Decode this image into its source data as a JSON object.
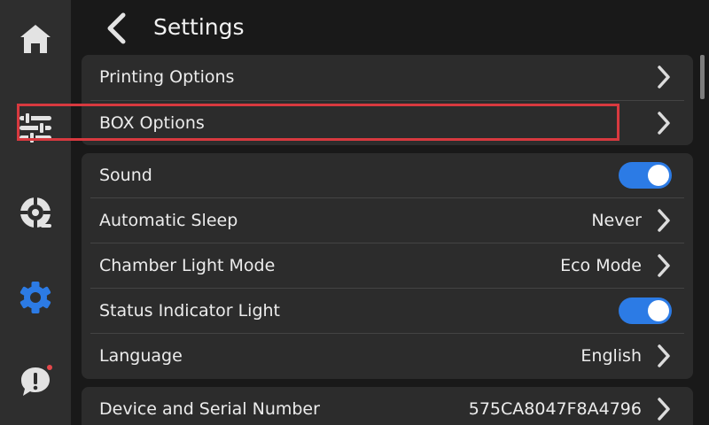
{
  "header": {
    "title": "Settings"
  },
  "colors": {
    "accent": "#2c7be5",
    "highlight": "#d8393f"
  },
  "sidebar": {
    "items": [
      {
        "name": "home",
        "icon": "home-icon"
      },
      {
        "name": "controls",
        "icon": "sliders-icon"
      },
      {
        "name": "filament",
        "icon": "filament-spool-icon"
      },
      {
        "name": "settings",
        "icon": "gear-icon",
        "active": true
      },
      {
        "name": "messages",
        "icon": "alert-message-icon",
        "badge": true
      }
    ]
  },
  "groups": [
    {
      "rows": [
        {
          "label": "Printing Options",
          "type": "link"
        },
        {
          "label": "BOX Options",
          "type": "link",
          "highlighted": true
        }
      ]
    },
    {
      "rows": [
        {
          "label": "Sound",
          "type": "toggle",
          "on": true
        },
        {
          "label": "Automatic Sleep",
          "type": "link",
          "value": "Never"
        },
        {
          "label": "Chamber Light Mode",
          "type": "link",
          "value": "Eco Mode"
        },
        {
          "label": "Status Indicator Light",
          "type": "toggle",
          "on": true
        },
        {
          "label": "Language",
          "type": "link",
          "value": "English"
        }
      ]
    },
    {
      "rows": [
        {
          "label": "Device and Serial Number",
          "type": "link",
          "value": "575CA8047F8A4796"
        }
      ]
    }
  ]
}
